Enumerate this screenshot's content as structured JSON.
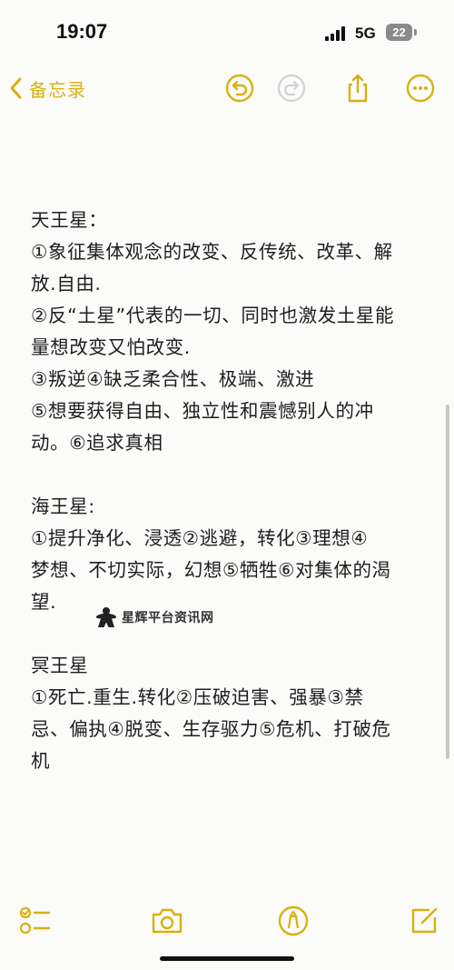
{
  "status_bar": {
    "time": "19:07",
    "network": "5G",
    "battery": "22"
  },
  "nav": {
    "back_label": "备忘录",
    "icons": [
      "chevron-left-icon",
      "undo-icon",
      "redo-icon",
      "share-icon",
      "more-icon"
    ]
  },
  "note": {
    "section1_title": "天王星：",
    "section1_lines": [
      "①象征集体观念的改变、反传统、改革、解",
      "放.自由.",
      "②反“土星”代表的一切、同时也激发土星能",
      "量想改变又怕改变.",
      "③叛逆④缺乏柔合性、极端、激进",
      "⑤想要获得自由、独立性和震憾别人的冲",
      "动。⑥追求真相"
    ],
    "section2_title": "海王星:",
    "section2_lines": [
      "①提升净化、浸透②逃避，转化③理想④",
      "梦想、不切实际，幻想⑤牺牲⑥对集体的渴",
      "望."
    ],
    "section3_title": "冥王星",
    "section3_lines": [
      "①死亡.重生.转化②压破迫害、强暴③禁",
      "忌、偏执④脱变、生存驱力⑤危机、打破危",
      "机"
    ]
  },
  "watermark": {
    "text": "星辉平台资讯网"
  },
  "toolbar": {
    "icons": [
      "checklist-icon",
      "camera-icon",
      "markup-pen-icon",
      "compose-icon"
    ]
  },
  "colors": {
    "accent": "#d9b10f",
    "background": "#fbfbf9",
    "text": "#1e1e1e"
  }
}
